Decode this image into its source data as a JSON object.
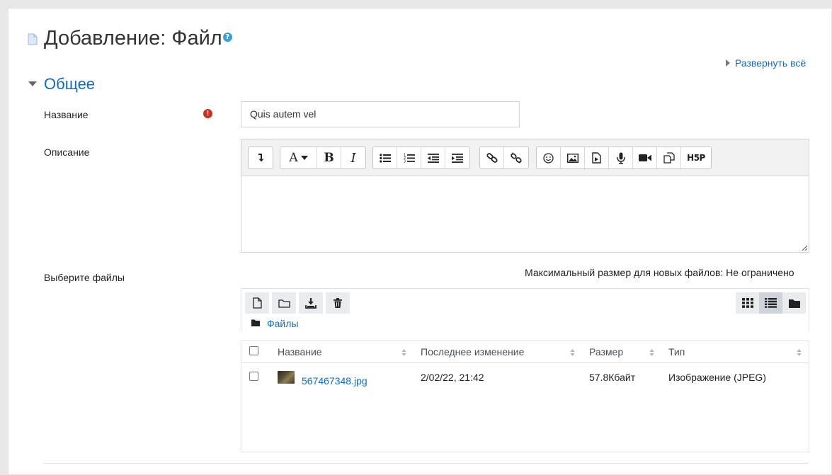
{
  "page": {
    "title": "Добавление: Файл",
    "expand_all": "Развернуть всё"
  },
  "section": {
    "title": "Общее"
  },
  "form": {
    "name_label": "Название",
    "name_value": "Quis autem vel",
    "description_label": "Описание",
    "files_label": "Выберите файлы",
    "max_size_text": "Максимальный размер для новых файлов: Не ограничено"
  },
  "editor": {
    "toolbar_groups": [
      [
        "collapse-icon"
      ],
      [
        "font-style-icon",
        "bold-icon",
        "italic-icon"
      ],
      [
        "unordered-list-icon",
        "ordered-list-icon",
        "outdent-icon",
        "indent-icon"
      ],
      [
        "link-icon",
        "unlink-icon"
      ],
      [
        "emoticon-icon",
        "image-icon",
        "media-icon",
        "record-audio-icon",
        "record-video-icon",
        "manage-files-icon",
        "h5p-icon"
      ]
    ],
    "font_btn": "A",
    "bold_btn": "B",
    "italic_btn": "I",
    "h5p_btn": "H5P",
    "content": ""
  },
  "filepicker": {
    "breadcrumb": "Файлы",
    "columns": [
      "Название",
      "Последнее изменение",
      "Размер",
      "Тип"
    ],
    "files": [
      {
        "name": "567467348.jpg",
        "modified": "2/02/22, 21:42",
        "size": "57.8Кбайт",
        "type": "Изображение (JPEG)"
      }
    ]
  },
  "colors": {
    "link": "#0f6cbf",
    "required": "#ca3120",
    "help": "#3a9fd6"
  }
}
